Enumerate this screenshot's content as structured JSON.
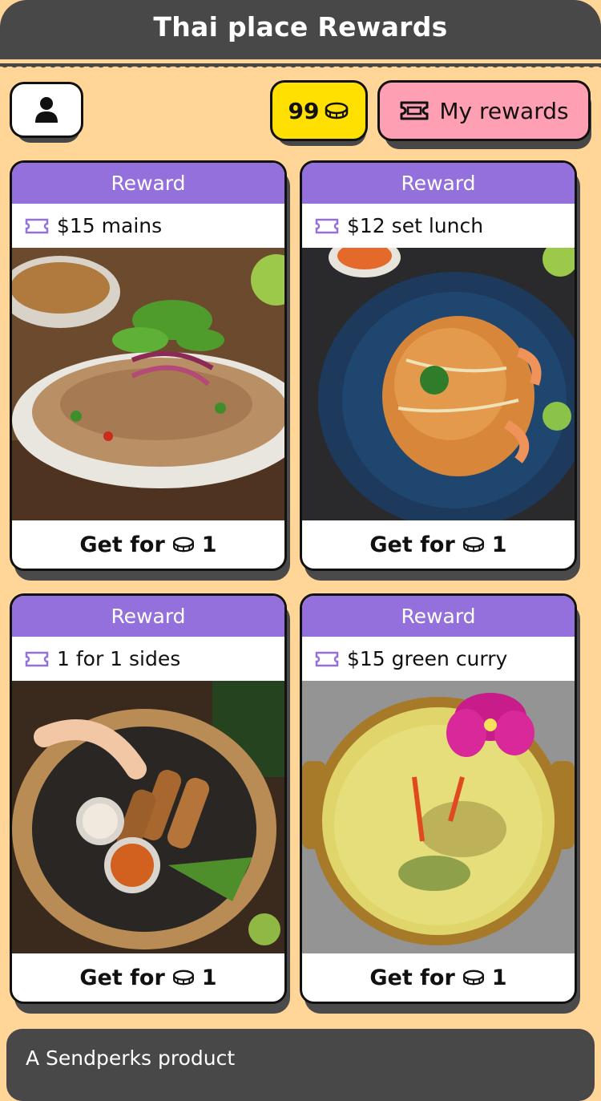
{
  "header": {
    "title": "Thai place Rewards"
  },
  "toolbar": {
    "profile_icon": "user-icon",
    "coins": "99",
    "coin_icon": "coin-stack-icon",
    "my_rewards_label": "My rewards",
    "ticket_icon": "ticket-icon"
  },
  "rewards": [
    {
      "tag": "Reward",
      "name": "$15 mains",
      "cta": "Get for",
      "cost": "1",
      "image": "larb-salad"
    },
    {
      "tag": "Reward",
      "name": "$12 set lunch",
      "cta": "Get for",
      "cost": "1",
      "image": "pad-thai"
    },
    {
      "tag": "Reward",
      "name": "1 for 1 sides",
      "cta": "Get for",
      "cost": "1",
      "image": "satay"
    },
    {
      "tag": "Reward",
      "name": "$15 green curry",
      "cta": "Get for",
      "cost": "1",
      "image": "green-curry"
    }
  ],
  "colors": {
    "background": "#ffd598",
    "header": "#484848",
    "card_header": "#9370db",
    "coins": "#ffe000",
    "rewards": "#ff9fb3"
  },
  "footer": {
    "text": "A Sendperks product"
  }
}
